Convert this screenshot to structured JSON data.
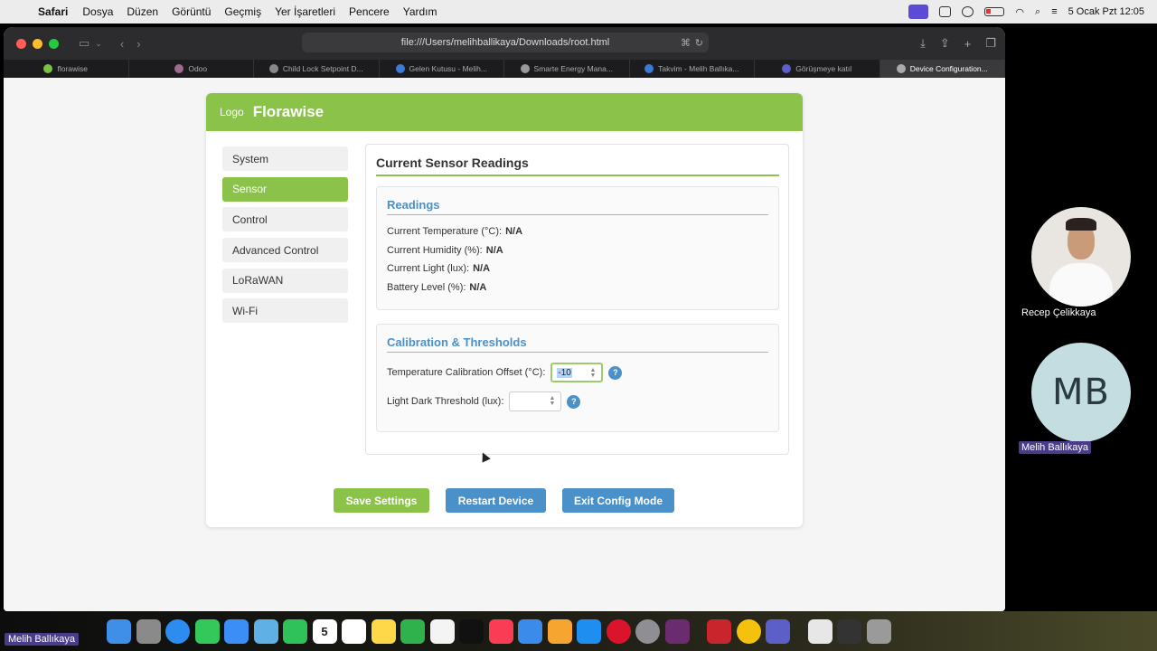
{
  "menubar": {
    "app_name": "Safari",
    "items": [
      "Dosya",
      "Düzen",
      "Görüntü",
      "Geçmiş",
      "Yer İşaretleri",
      "Pencere",
      "Yardım"
    ],
    "datetime": "5 Ocak Pzt  12:05"
  },
  "browser": {
    "address": "file:///Users/melihballikaya/Downloads/root.html",
    "tabs": [
      {
        "label": "florawise",
        "fav_color": "#7cc242"
      },
      {
        "label": "Odoo",
        "fav_color": "#9c6b8d"
      },
      {
        "label": "Child Lock Setpoint D...",
        "fav_color": "#888888"
      },
      {
        "label": "Gelen Kutusu - Melih...",
        "fav_color": "#3b7bd8"
      },
      {
        "label": "Smarte Energy Mana...",
        "fav_color": "#999999"
      },
      {
        "label": "Takvim - Melih Ballıka...",
        "fav_color": "#3b7bd8"
      },
      {
        "label": "Görüşmeye katıl",
        "fav_color": "#5b5fc7"
      },
      {
        "label": "Device Configuration...",
        "fav_color": "#aaaaaa"
      }
    ]
  },
  "page": {
    "logo": "Logo",
    "brand": "Florawise",
    "colors": {
      "accent": "#8bc34a",
      "link": "#4a90c9"
    },
    "sidebar": [
      {
        "label": "System"
      },
      {
        "label": "Sensor"
      },
      {
        "label": "Control"
      },
      {
        "label": "Advanced Control"
      },
      {
        "label": "LoRaWAN"
      },
      {
        "label": "Wi-Fi"
      }
    ],
    "active_tab": "Sensor",
    "main_title": "Current Sensor Readings",
    "readings": {
      "title": "Readings",
      "temperature_label": "Current Temperature (°C):",
      "temperature_value": "N/A",
      "humidity_label": "Current Humidity (%):",
      "humidity_value": "N/A",
      "light_label": "Current Light (lux):",
      "light_value": "N/A",
      "battery_label": "Battery Level (%):",
      "battery_value": "N/A"
    },
    "calibration": {
      "title": "Calibration & Thresholds",
      "temp_offset_label": "Temperature Calibration Offset (°C):",
      "temp_offset_value": "-10",
      "light_threshold_label": "Light Dark Threshold (lux):",
      "light_threshold_value": "",
      "help": "?"
    },
    "buttons": {
      "save": "Save Settings",
      "restart": "Restart Device",
      "exit": "Exit Config Mode"
    }
  },
  "call": {
    "participant1": "Recep Çelikkaya",
    "participant2_initials": "MB",
    "participant2": "Melih Ballıkaya",
    "self_label": "Melih Ballıkaya"
  },
  "dock": {
    "icons": [
      "finder-icon",
      "launchpad-icon",
      "safari-icon",
      "messages-icon",
      "mail-icon",
      "maps-icon",
      "facetime-icon",
      "calendar-icon",
      "reminders-icon",
      "notes-icon",
      "numbers-icon",
      "freeform-icon",
      "tv-icon",
      "music-icon",
      "keynote-icon",
      "pages-icon",
      "appstore-icon",
      "opera-icon",
      "settings-icon",
      "app-icon",
      "acrobat-icon",
      "chrome-icon",
      "teams-icon",
      "preview-icon",
      "app2-icon",
      "trash-icon"
    ],
    "calendar_day": "5"
  }
}
